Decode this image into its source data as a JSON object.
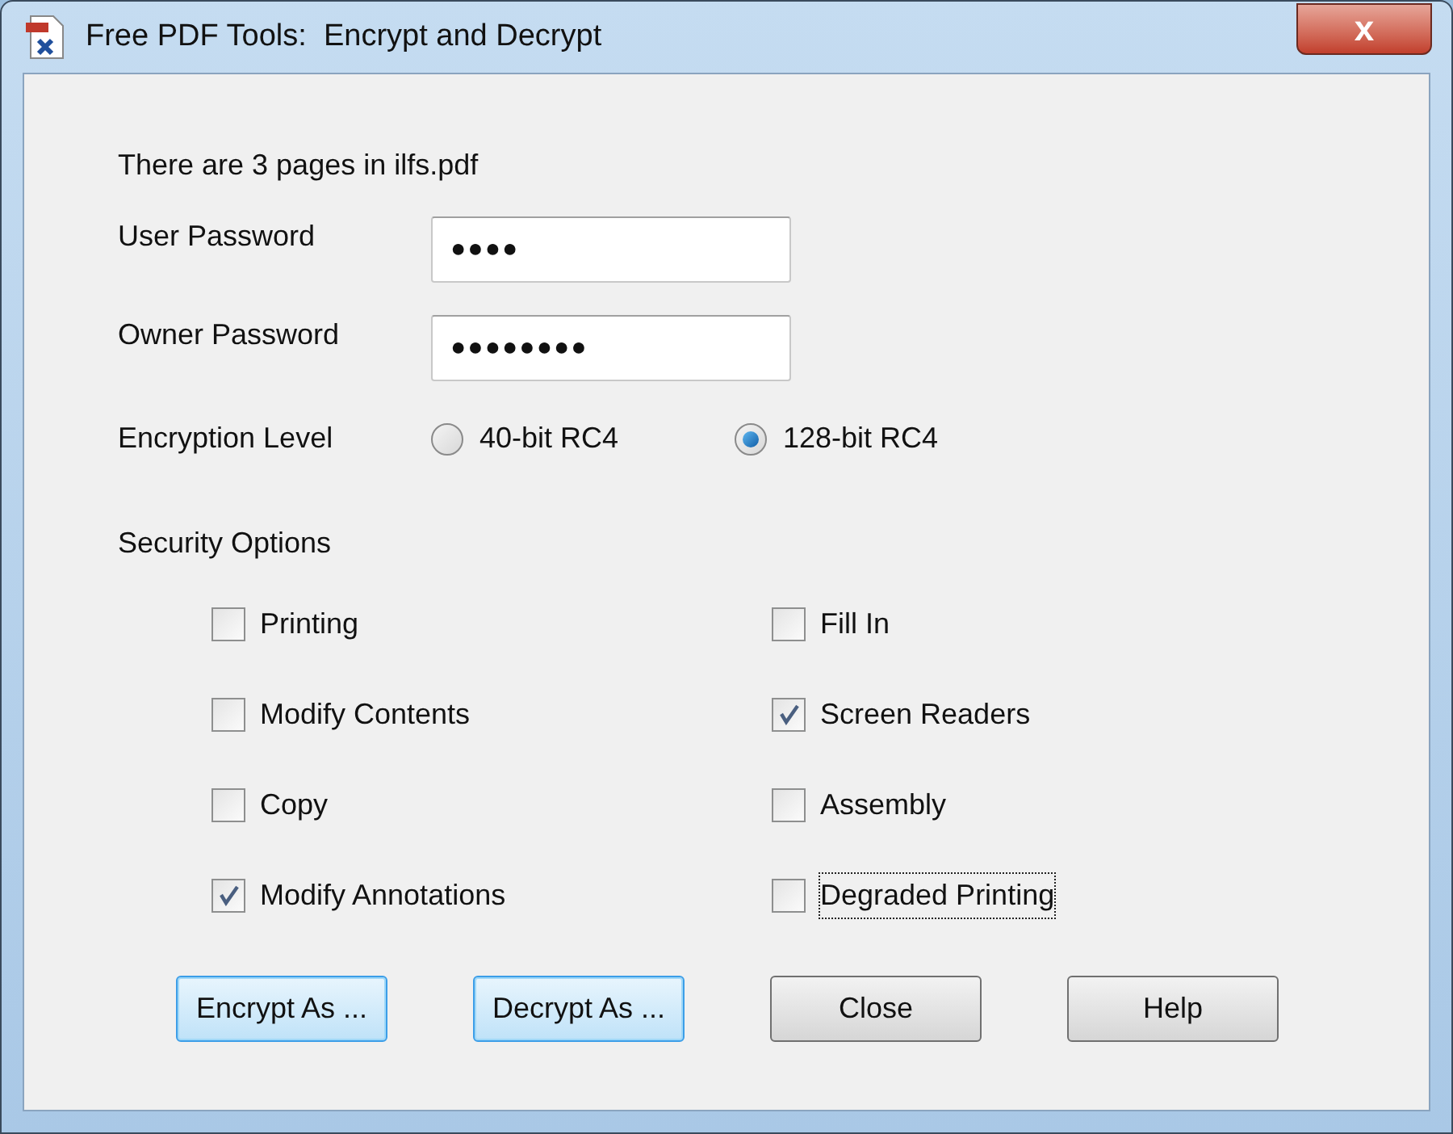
{
  "window": {
    "title": "Free PDF Tools:  Encrypt and Decrypt",
    "close_label": "x"
  },
  "info": "There are 3 pages in ilfs.pdf",
  "fields": [
    {
      "label": "User Password",
      "value": "●●●●"
    },
    {
      "label": "Owner Password",
      "value": "●●●●●●●●"
    }
  ],
  "encryption": {
    "label": "Encryption Level",
    "options": [
      {
        "label": "40-bit RC4",
        "selected": false
      },
      {
        "label": "128-bit RC4",
        "selected": true
      }
    ]
  },
  "security": {
    "label": "Security Options",
    "options": [
      {
        "label": "Printing",
        "checked": false,
        "focused": false
      },
      {
        "label": "Fill In",
        "checked": false,
        "focused": false
      },
      {
        "label": "Modify Contents",
        "checked": false,
        "focused": false
      },
      {
        "label": "Screen Readers",
        "checked": true,
        "focused": false
      },
      {
        "label": "Copy",
        "checked": false,
        "focused": false
      },
      {
        "label": "Assembly",
        "checked": false,
        "focused": false
      },
      {
        "label": "Modify Annotations",
        "checked": true,
        "focused": false
      },
      {
        "label": "Degraded Printing",
        "checked": false,
        "focused": true
      }
    ]
  },
  "buttons": [
    {
      "label": "Encrypt As ...",
      "highlighted": true
    },
    {
      "label": "Decrypt As ...",
      "highlighted": true
    },
    {
      "label": "Close",
      "highlighted": false
    },
    {
      "label": "Help",
      "highlighted": false
    }
  ]
}
